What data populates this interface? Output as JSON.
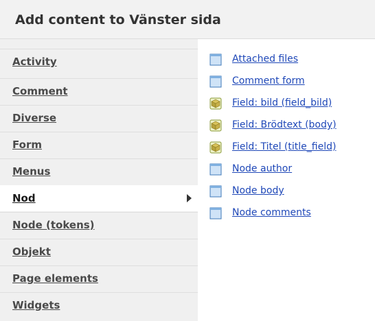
{
  "header": {
    "title": "Add content to Vänster sida"
  },
  "categories": [
    {
      "label": "Activity"
    },
    {
      "label": "Comment"
    },
    {
      "label": "Diverse"
    },
    {
      "label": "Form"
    },
    {
      "label": "Menus"
    },
    {
      "label": "Nod",
      "active": true
    },
    {
      "label": "Node (tokens)"
    },
    {
      "label": "Objekt"
    },
    {
      "label": "Page elements"
    },
    {
      "label": "Widgets"
    }
  ],
  "content_items": [
    {
      "label": "Attached files",
      "icon": "document-icon"
    },
    {
      "label": "Comment form",
      "icon": "document-icon"
    },
    {
      "label": "Field: bild (field_bild)",
      "icon": "cube-icon"
    },
    {
      "label": "Field: Brödtext (body)",
      "icon": "cube-icon"
    },
    {
      "label": "Field: Titel (title_field)",
      "icon": "cube-icon"
    },
    {
      "label": "Node author",
      "icon": "document-icon"
    },
    {
      "label": "Node body",
      "icon": "document-icon"
    },
    {
      "label": "Node comments",
      "icon": "document-icon"
    }
  ],
  "colors": {
    "link": "#1f48b8",
    "sidebar_bg": "#f0f0f0",
    "header_bg": "#f2f2f2"
  }
}
